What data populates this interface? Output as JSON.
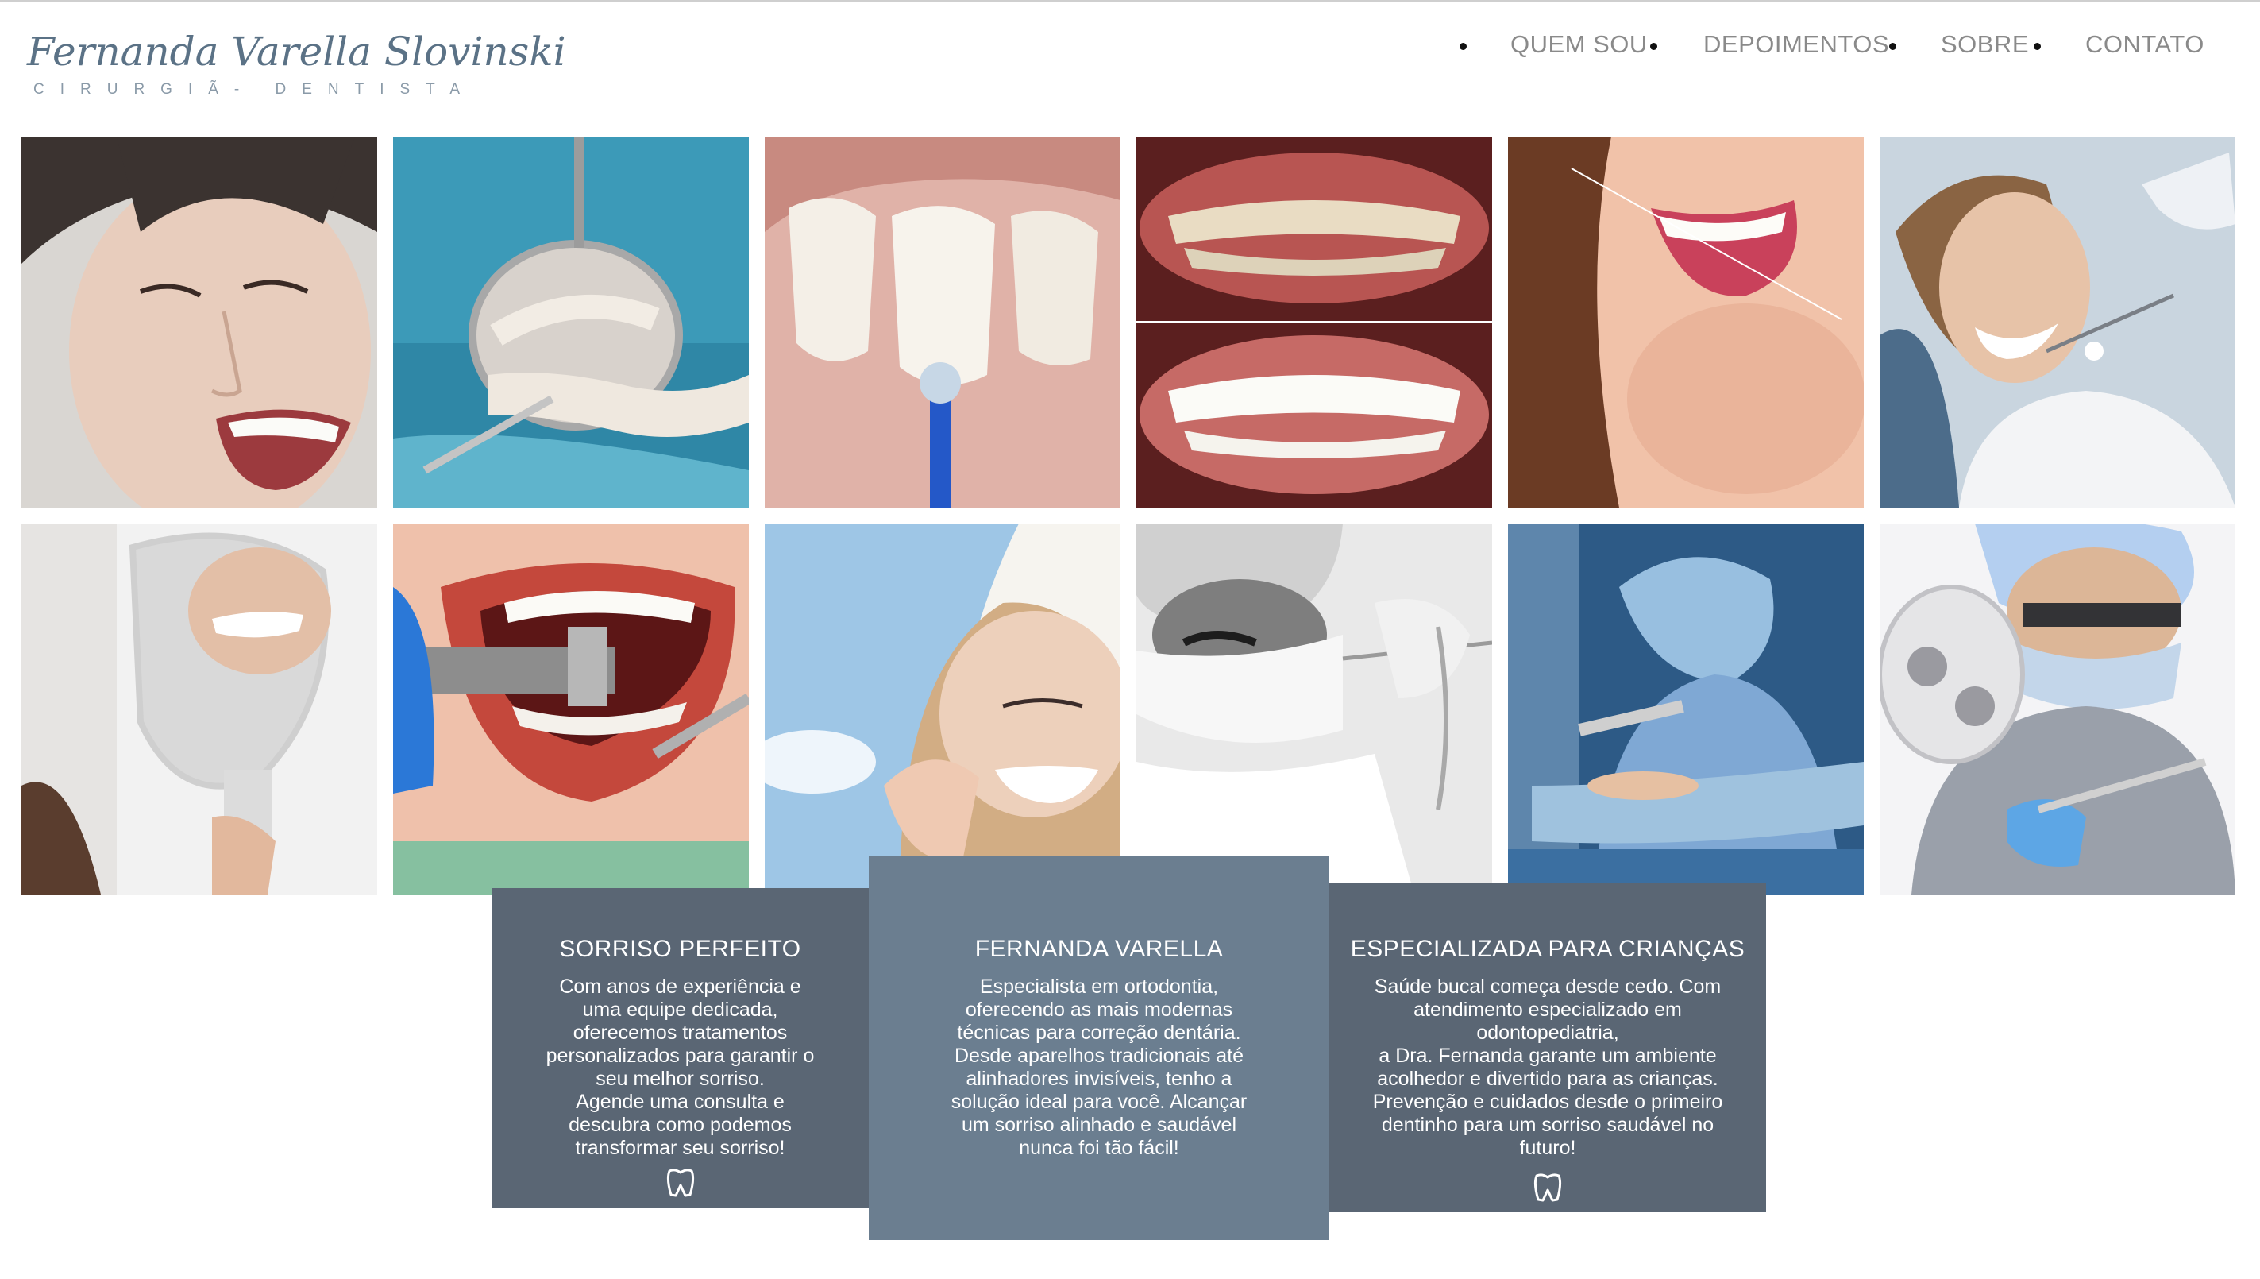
{
  "logo": {
    "name": "Fernanda Varella Slovinski",
    "subtitle": "CIRURGIÃ- DENTISTA"
  },
  "nav": {
    "items": [
      "QUEM SOU",
      "DEPOIMENTOS",
      "SOBRE",
      "CONTATO"
    ]
  },
  "gallery": {
    "photos": [
      "smiling-woman-photo",
      "dental-mirror-photo",
      "veneer-application-photo",
      "before-after-teeth-photo",
      "flossing-smile-photo",
      "dental-patient-photo",
      "mirror-smile-photo",
      "dental-drill-photo",
      "floss-woman-photo",
      "masked-dentist-photo",
      "surgery-team-photo",
      "dentist-at-work-photo"
    ]
  },
  "cards": [
    {
      "title": "SORRISO PERFEITO",
      "text": "Com anos de experiência e\numa equipe dedicada,\noferecemos tratamentos\npersonalizados para garantir o\nseu melhor sorriso.\nAgende uma consulta e\ndescubra como podemos\ntransformar seu sorriso!",
      "icon": "tooth-icon"
    },
    {
      "title": "FERNANDA VARELLA",
      "text": "Especialista em ortodontia,\noferecendo as mais modernas\ntécnicas para correção dentária.\nDesde aparelhos tradicionais até\nalinhadores invisíveis, tenho a\nsolução ideal para você. Alcançar\num sorriso alinhado e saudável\nnunca foi tão fácil!",
      "icon": "none"
    },
    {
      "title": "ESPECIALIZADA PARA CRIANÇAS",
      "text": "Saúde bucal começa desde cedo. Com\natendimento especializado em\nodontopediatria,\na Dra. Fernanda garante um ambiente\nacolhedor e divertido para as crianças.\nPrevenção e cuidados desde o primeiro\ndentinho para um sorriso saudável no\nfuturo!",
      "icon": "tooth-icon"
    }
  ],
  "colors": {
    "card_dark": "#5a6674",
    "card_mid": "#6b7e90",
    "nav_text": "#8a8a8a",
    "logo": "#5b7286"
  }
}
